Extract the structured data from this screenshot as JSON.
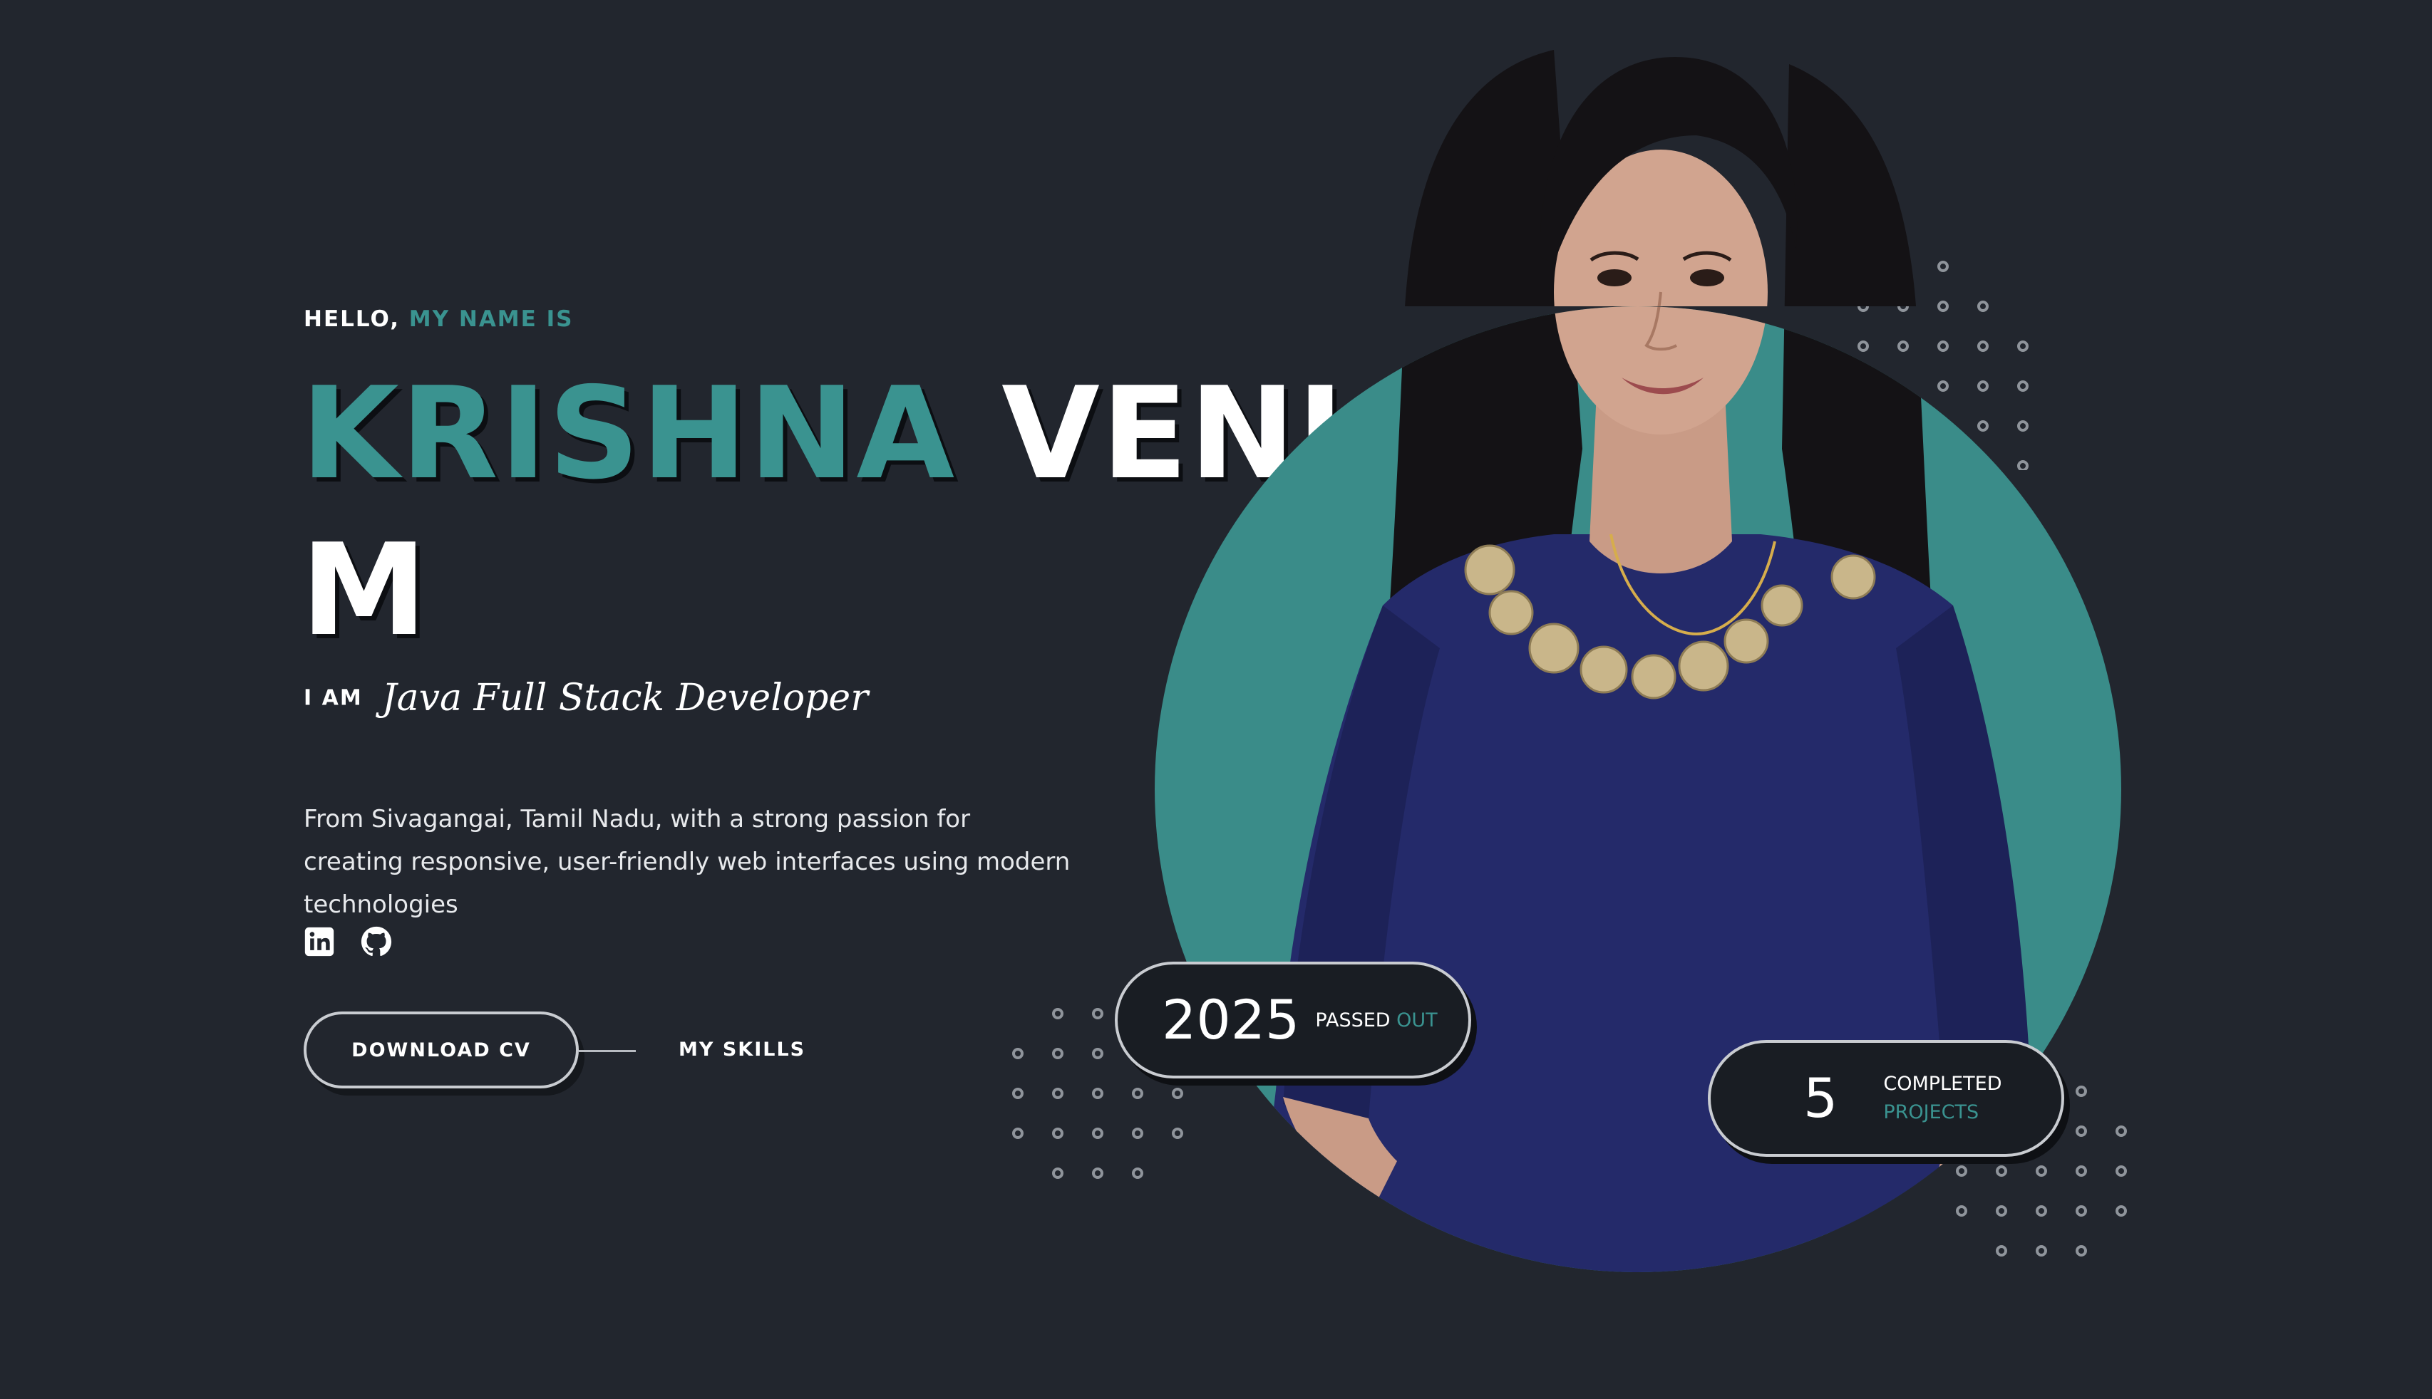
{
  "hero": {
    "greeting_prefix": "HELLO,",
    "greeting_accent": "MY NAME IS",
    "name_first": "KRISHNA",
    "name_middle": "VENI",
    "name_last": "M",
    "role_prefix": "I AM",
    "role_title": "Java Full Stack Developer",
    "bio": "From Sivagangai, Tamil Nadu, with a strong passion for creating responsive, user-friendly web interfaces using modern technologies"
  },
  "socials": [
    {
      "icon": "linkedin-icon"
    },
    {
      "icon": "github-icon"
    }
  ],
  "actions": {
    "download_cv": "DOWNLOAD CV",
    "my_skills": "MY SKILLS"
  },
  "stats": {
    "year_value": "2025",
    "year_label_white": "PASSED",
    "year_label_teal": "OUT",
    "projects_value": "5",
    "projects_label_white": "COMPLETED",
    "projects_label_teal": "PROJECTS"
  },
  "colors": {
    "background": "#22262e",
    "accent": "#3a9390",
    "circle": "#3a8c89",
    "pill_background": "#191d23",
    "outline": "#c9ccd1",
    "dress": "#242a6a"
  }
}
